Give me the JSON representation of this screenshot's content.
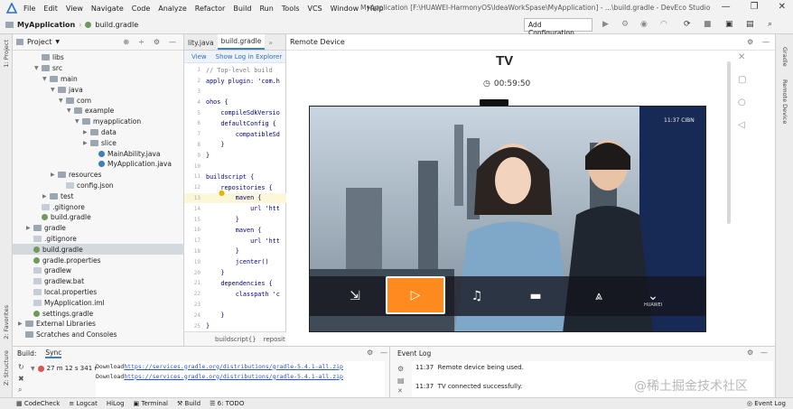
{
  "window": {
    "title": "MyApplication [F:\\HUAWEI-HarmonyOS\\IdeaWorkSpase\\MyApplication] - ...\\build.gradle - DevEco Studio",
    "menu": [
      "File",
      "Edit",
      "View",
      "Navigate",
      "Code",
      "Analyze",
      "Refactor",
      "Build",
      "Run",
      "Tools",
      "VCS",
      "Window",
      "Help"
    ]
  },
  "toolbar": {
    "project_name": "MyApplication",
    "file_name": "build.gradle",
    "config_label": "Add Configuration..."
  },
  "project_panel": {
    "label": "Project",
    "strip_label": "1: Project",
    "tree": [
      {
        "label": "libs",
        "indent": 2,
        "type": "folder",
        "arrow": ""
      },
      {
        "label": "src",
        "indent": 2,
        "type": "folder",
        "arrow": "▼"
      },
      {
        "label": "main",
        "indent": 3,
        "type": "folder",
        "arrow": "▼"
      },
      {
        "label": "java",
        "indent": 4,
        "type": "folder",
        "arrow": "▼"
      },
      {
        "label": "com",
        "indent": 5,
        "type": "folder",
        "arrow": "▼"
      },
      {
        "label": "example",
        "indent": 6,
        "type": "folder",
        "arrow": "▼"
      },
      {
        "label": "myapplication",
        "indent": 7,
        "type": "folder",
        "arrow": "▼"
      },
      {
        "label": "data",
        "indent": 8,
        "type": "folder",
        "arrow": "▶"
      },
      {
        "label": "slice",
        "indent": 8,
        "type": "folder",
        "arrow": "▶"
      },
      {
        "label": "MainAbility.java",
        "indent": 9,
        "type": "java",
        "arrow": ""
      },
      {
        "label": "MyApplication.java",
        "indent": 9,
        "type": "java",
        "arrow": ""
      },
      {
        "label": "resources",
        "indent": 4,
        "type": "folder",
        "arrow": "▶"
      },
      {
        "label": "config.json",
        "indent": 5,
        "type": "file",
        "arrow": ""
      },
      {
        "label": "test",
        "indent": 3,
        "type": "folder",
        "arrow": "▶"
      },
      {
        "label": ".gitignore",
        "indent": 2,
        "type": "file",
        "arrow": ""
      },
      {
        "label": "build.gradle",
        "indent": 2,
        "type": "gradle",
        "arrow": ""
      },
      {
        "label": "gradle",
        "indent": 1,
        "type": "folder",
        "arrow": "▶"
      },
      {
        "label": ".gitignore",
        "indent": 1,
        "type": "file",
        "arrow": ""
      },
      {
        "label": "build.gradle",
        "indent": 1,
        "type": "gradle",
        "arrow": "",
        "selected": true
      },
      {
        "label": "gradle.properties",
        "indent": 1,
        "type": "gradle",
        "arrow": ""
      },
      {
        "label": "gradlew",
        "indent": 1,
        "type": "file",
        "arrow": ""
      },
      {
        "label": "gradlew.bat",
        "indent": 1,
        "type": "file",
        "arrow": ""
      },
      {
        "label": "local.properties",
        "indent": 1,
        "type": "file",
        "arrow": ""
      },
      {
        "label": "MyApplication.iml",
        "indent": 1,
        "type": "file",
        "arrow": ""
      },
      {
        "label": "settings.gradle",
        "indent": 1,
        "type": "gradle",
        "arrow": ""
      },
      {
        "label": "External Libraries",
        "indent": 0,
        "type": "folder",
        "arrow": "▶"
      },
      {
        "label": "Scratches and Consoles",
        "indent": 0,
        "type": "folder",
        "arrow": ""
      }
    ]
  },
  "editor": {
    "tabs": [
      "lity.java",
      "build.gradle"
    ],
    "notice_view": "View",
    "notice_link": "Show Log in Explorer",
    "lines": [
      {
        "n": "1",
        "t": "// Top-level build"
      },
      {
        "n": "2",
        "t": "apply plugin: 'com.h"
      },
      {
        "n": "3",
        "t": ""
      },
      {
        "n": "4",
        "t": "ohos {"
      },
      {
        "n": "5",
        "t": "    compileSdkVersio"
      },
      {
        "n": "6",
        "t": "    defaultConfig {"
      },
      {
        "n": "7",
        "t": "        compatibleSd"
      },
      {
        "n": "8",
        "t": "    }"
      },
      {
        "n": "9",
        "t": "}"
      },
      {
        "n": "10",
        "t": ""
      },
      {
        "n": "11",
        "t": "buildscript {"
      },
      {
        "n": "12",
        "t": "    repositories {"
      },
      {
        "n": "13",
        "t": "        maven {"
      },
      {
        "n": "14",
        "t": "            url 'htt"
      },
      {
        "n": "15",
        "t": "        }"
      },
      {
        "n": "16",
        "t": "        maven {"
      },
      {
        "n": "17",
        "t": "            url 'htt"
      },
      {
        "n": "18",
        "t": "        }"
      },
      {
        "n": "19",
        "t": "        jcenter()"
      },
      {
        "n": "20",
        "t": "    }"
      },
      {
        "n": "21",
        "t": "    dependencies {"
      },
      {
        "n": "22",
        "t": "        classpath 'c"
      },
      {
        "n": "23",
        "t": ""
      },
      {
        "n": "24",
        "t": "    }"
      },
      {
        "n": "25",
        "t": "}"
      }
    ],
    "breadcrumb": [
      "buildscript{}",
      "reposit"
    ]
  },
  "remote_device": {
    "label": "Remote Device",
    "device_name": "TV",
    "time_remaining": "00:59:50",
    "screen_time": "11:37",
    "channel": "CIBN",
    "brand": "HUAWEI"
  },
  "build_panel": {
    "label": "Build:",
    "tab": "Sync",
    "status": "27 m 12 s 341 ms",
    "log": [
      {
        "prefix": "Download ",
        "url": "https://services.gradle.org/distributions/gradle-5.4.1-all.zip"
      },
      {
        "prefix": "Download ",
        "url": "https://services.gradle.org/distributions/gradle-5.4.1-all.zip"
      }
    ]
  },
  "event_log": {
    "label": "Event Log",
    "entries": [
      {
        "time": "11:37",
        "text": "Remote device being used."
      },
      {
        "time": "11:37",
        "text": "TV connected successfully."
      }
    ]
  },
  "status_bar": {
    "items": [
      "CodeCheck",
      "Logcat",
      "HiLog",
      "Terminal",
      "Build",
      "6: TODO"
    ],
    "event_log": "Event Log"
  },
  "side_labels": {
    "gradle": "Gradle",
    "remote_device": "Remote Device",
    "favorites": "2: Favorites",
    "structure": "Z: Structure"
  },
  "watermark": "@稀土掘金技术社区"
}
